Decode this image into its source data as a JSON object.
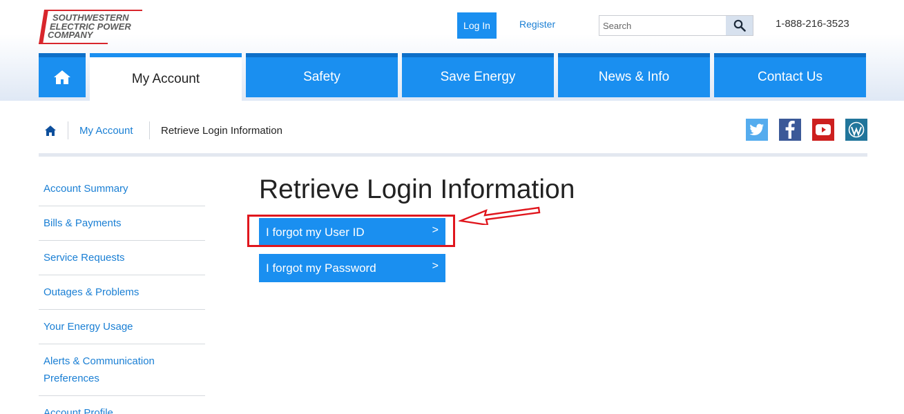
{
  "header": {
    "logo_lines": [
      "SOUTHWESTERN",
      "ELECTRIC POWER",
      "COMPANY"
    ],
    "login_label": "Log In",
    "register_label": "Register",
    "search_placeholder": "Search",
    "phone": "1-888-216-3523"
  },
  "nav": {
    "items": [
      {
        "label": "My Account",
        "active": true
      },
      {
        "label": "Safety",
        "active": false
      },
      {
        "label": "Save Energy",
        "active": false
      },
      {
        "label": "News & Info",
        "active": false
      },
      {
        "label": "Contact Us",
        "active": false
      }
    ]
  },
  "breadcrumb": {
    "link_label": "My Account",
    "current_label": "Retrieve Login Information"
  },
  "social": [
    {
      "icon": "twitter-icon",
      "color": "#55acee"
    },
    {
      "icon": "facebook-icon",
      "color": "#3b5998"
    },
    {
      "icon": "youtube-icon",
      "color": "#cd201f"
    },
    {
      "icon": "wordpress-icon",
      "color": "#21759b"
    }
  ],
  "sidebar": {
    "items": [
      {
        "label": "Account Summary"
      },
      {
        "label": "Bills & Payments"
      },
      {
        "label": "Service Requests"
      },
      {
        "label": "Outages & Problems"
      },
      {
        "label": "Your Energy Usage"
      },
      {
        "label": "Alerts & Communication Preferences"
      },
      {
        "label": "Account Profile"
      }
    ]
  },
  "main": {
    "title": "Retrieve Login Information",
    "buttons": [
      {
        "label": "I forgot my User ID",
        "chevron": ">"
      },
      {
        "label": "I forgot my Password",
        "chevron": ">"
      }
    ]
  },
  "colors": {
    "accent": "#1a8ff0",
    "annotation": "#e0161d"
  }
}
